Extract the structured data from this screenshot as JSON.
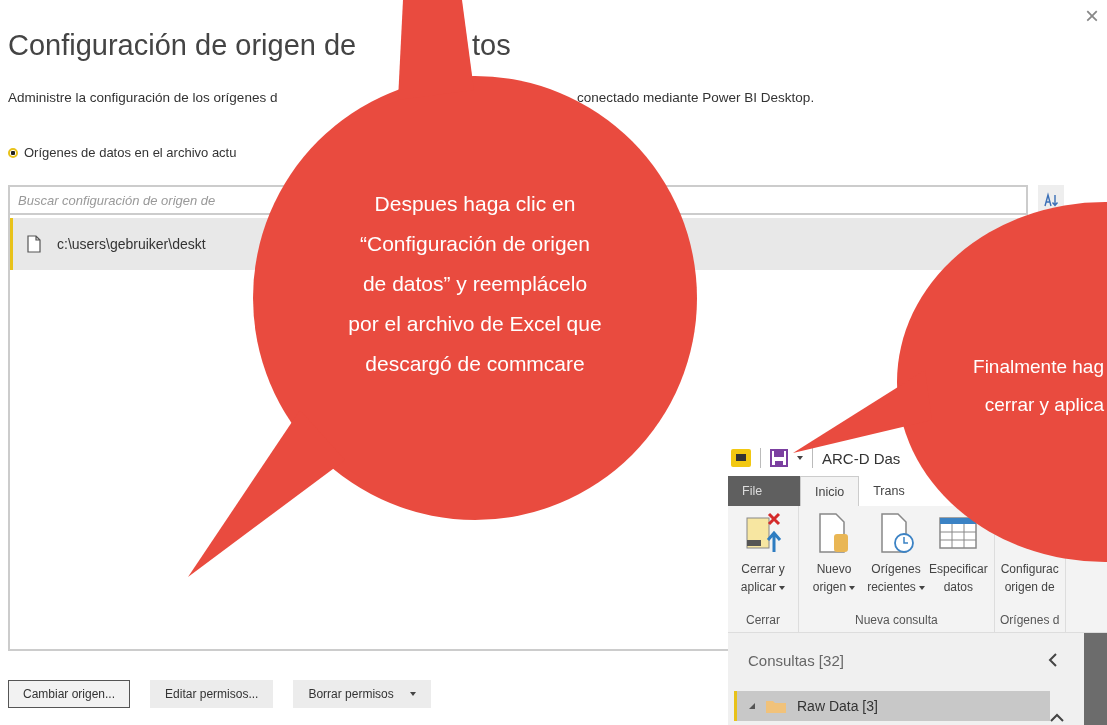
{
  "dialog": {
    "title_parts": [
      "Configuración de origen de",
      "tos"
    ],
    "close": "×",
    "description_parts": [
      "Administre la configuración de los orígenes d",
      "conectado mediante Power BI Desktop."
    ],
    "scope_options": [
      {
        "label": "Orígenes de datos en el archivo actu",
        "selected": true
      }
    ],
    "search": {
      "placeholder": "Buscar configuración de origen de"
    },
    "sources": [
      {
        "path": "c:\\users\\gebruiker\\deskt",
        "selected": true
      }
    ],
    "buttons": [
      {
        "label": "Cambiar origen...",
        "kind": "default"
      },
      {
        "label": "Editar permisos...",
        "kind": "plain"
      },
      {
        "label": "Borrar permisos",
        "kind": "dropdown"
      }
    ]
  },
  "editor": {
    "title": "ARC-D Das",
    "tabs": [
      {
        "label": "File",
        "kind": "file",
        "selected": false
      },
      {
        "label": "Inicio",
        "kind": "tab",
        "selected": true
      },
      {
        "label": "Trans",
        "kind": "tab",
        "selected": false
      }
    ],
    "ribbon_groups": [
      {
        "label": "Cerrar",
        "commands": [
          {
            "label": "Cerrar y\naplicar",
            "kind": "close-apply",
            "dropdown": true
          }
        ]
      },
      {
        "label": "Nueva consulta",
        "commands": [
          {
            "label": "Nuevo\norigen",
            "kind": "new-source",
            "dropdown": true
          },
          {
            "label": "Orígenes\nrecientes",
            "kind": "recent",
            "dropdown": true
          },
          {
            "label": "Especificar\ndatos",
            "kind": "table",
            "dropdown": false
          }
        ]
      },
      {
        "label": "Orígenes d",
        "commands": [
          {
            "label": "Configurac\norigen de",
            "kind": "settings",
            "dropdown": false
          }
        ]
      }
    ],
    "queries": {
      "title": "Consultas [32]",
      "items": [
        {
          "label": "Raw Data [3]",
          "selected": true,
          "expanded": true
        }
      ]
    }
  },
  "callouts": [
    {
      "text": "Despues haga clic en\n“Configuración de origen\nde datos” y reemplácelo\npor el archivo de Excel que\ndescargó de commcare"
    },
    {
      "text": "Finalmente hag\ncerrar y aplica"
    }
  ]
}
